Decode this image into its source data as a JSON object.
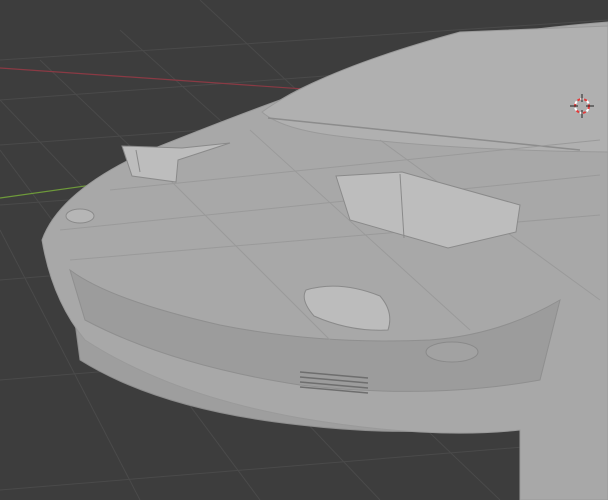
{
  "app": {
    "name": "3D viewport",
    "background_color": "#3d3d3d",
    "grid_color": "#4a4a4a",
    "x_axis_color": "#8a3a44",
    "y_axis_color": "#6e9a3a"
  },
  "scene": {
    "object": "car-front-mesh",
    "shading": "solid",
    "mesh_color": "#a8a8a8",
    "mesh_shadow_color": "#8c8c8c",
    "edge_color": "#9a9a9a"
  },
  "cursor": {
    "icon": "3d-cursor-icon",
    "ring_colors": [
      "#e23a3a",
      "#ffffff"
    ]
  }
}
